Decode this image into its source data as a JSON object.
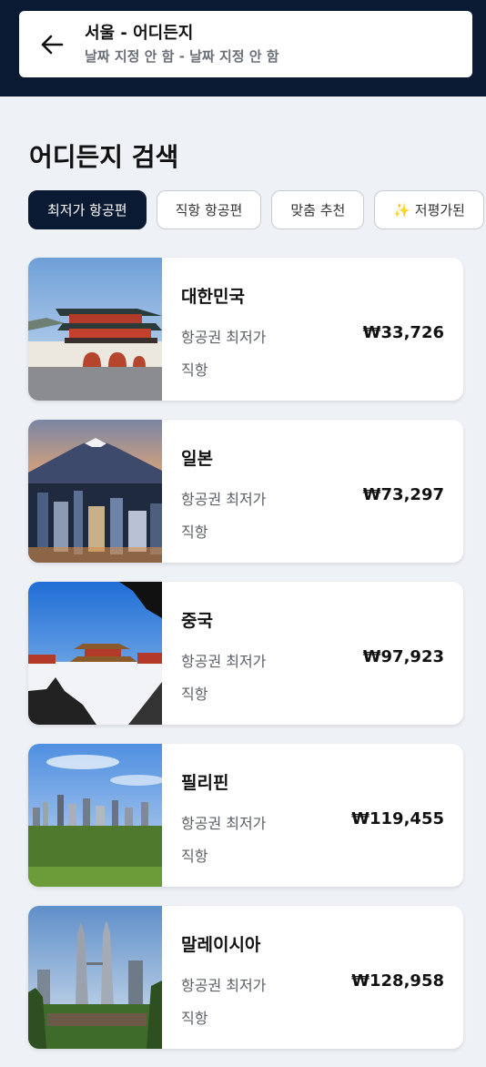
{
  "header": {
    "route_title": "서울 - 어디든지",
    "route_dates": "날짜 지정 안 함 - 날짜 지정 안 함",
    "back_icon": "arrow-left-icon"
  },
  "page": {
    "title": "어디든지 검색"
  },
  "filters": [
    {
      "label": "최저가 항공편",
      "active": true
    },
    {
      "label": "직항 항공편",
      "active": false
    },
    {
      "label": "맞춤 추천",
      "active": false
    },
    {
      "label": "✨ 저평가된",
      "active": false
    }
  ],
  "destinations": [
    {
      "country": "대한민국",
      "price_label": "항공권 최저가",
      "price": "₩33,726",
      "stops": "직항",
      "image": "palace-photo"
    },
    {
      "country": "일본",
      "price_label": "항공권 최저가",
      "price": "₩73,297",
      "stops": "직항",
      "image": "fuji-city-photo"
    },
    {
      "country": "중국",
      "price_label": "항공권 최저가",
      "price": "₩97,923",
      "stops": "직항",
      "image": "forbidden-city-photo"
    },
    {
      "country": "필리핀",
      "price_label": "항공권 최저가",
      "price": "₩119,455",
      "stops": "직항",
      "image": "manila-skyline-photo"
    },
    {
      "country": "말레이시아",
      "price_label": "항공권 최저가",
      "price": "₩128,958",
      "stops": "직항",
      "image": "petronas-towers-photo"
    }
  ],
  "colors": {
    "navy": "#0b1a33",
    "background": "#eef1f6",
    "card": "#ffffff"
  }
}
